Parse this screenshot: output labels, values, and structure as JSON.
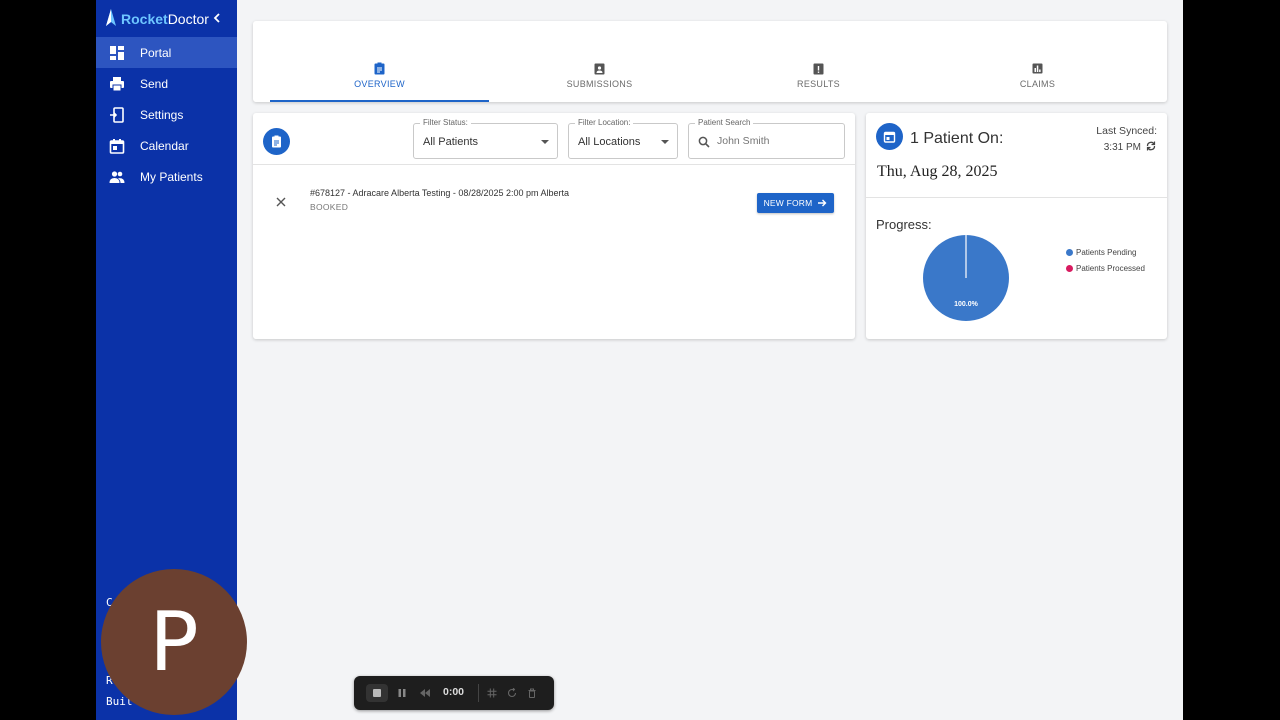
{
  "brand": {
    "name_part1": "Rocket",
    "name_part2": "Doctor"
  },
  "sidebar": {
    "items": [
      {
        "label": "Portal",
        "icon": "dashboard-icon",
        "active": true
      },
      {
        "label": "Send",
        "icon": "printer-icon",
        "active": false
      },
      {
        "label": "Settings",
        "icon": "settings-phone-icon",
        "active": false
      },
      {
        "label": "Calendar",
        "icon": "calendar-icon",
        "active": false
      },
      {
        "label": "My Patients",
        "icon": "people-icon",
        "active": false
      }
    ],
    "avatar_letter": "P",
    "footer_char1": "C",
    "footer_char2": "R",
    "footer_text": "Buil"
  },
  "tabs": [
    {
      "label": "OVERVIEW",
      "icon": "clipboard-icon",
      "active": true
    },
    {
      "label": "SUBMISSIONS",
      "icon": "badge-icon",
      "active": false
    },
    {
      "label": "RESULTS",
      "icon": "alert-clipboard-icon",
      "active": false
    },
    {
      "label": "CLAIMS",
      "icon": "bar-chart-icon",
      "active": false
    }
  ],
  "filters": {
    "status_label": "Filter Status:",
    "status_value": "All Patients",
    "location_label": "Filter Location:",
    "location_value": "All Locations",
    "search_label": "Patient Search",
    "search_placeholder": "John Smith"
  },
  "appointment": {
    "title": "#678127 - Adracare Alberta Testing - 08/28/2025 2:00 pm Alberta",
    "status": "BOOKED",
    "new_form_label": "NEW FORM"
  },
  "stats": {
    "title": "1 Patient On:",
    "last_synced_label": "Last Synced:",
    "last_synced_time": "3:31 PM",
    "date": "Thu, Aug 28, 2025",
    "progress_label": "Progress:",
    "pie_label": "100.0%",
    "legend": [
      {
        "label": "Patients Pending",
        "color": "#3a78c9"
      },
      {
        "label": "Patients Processed",
        "color": "#d81b60"
      }
    ]
  },
  "chart_data": {
    "type": "pie",
    "categories": [
      "Patients Pending",
      "Patients Processed"
    ],
    "values": [
      100.0,
      0.0
    ],
    "title": "Progress:"
  },
  "recorder": {
    "time": "0:00"
  },
  "colors": {
    "sidebar": "#0b32a8",
    "primary": "#1e64c8",
    "accent_yellow": "#f2c40f"
  }
}
